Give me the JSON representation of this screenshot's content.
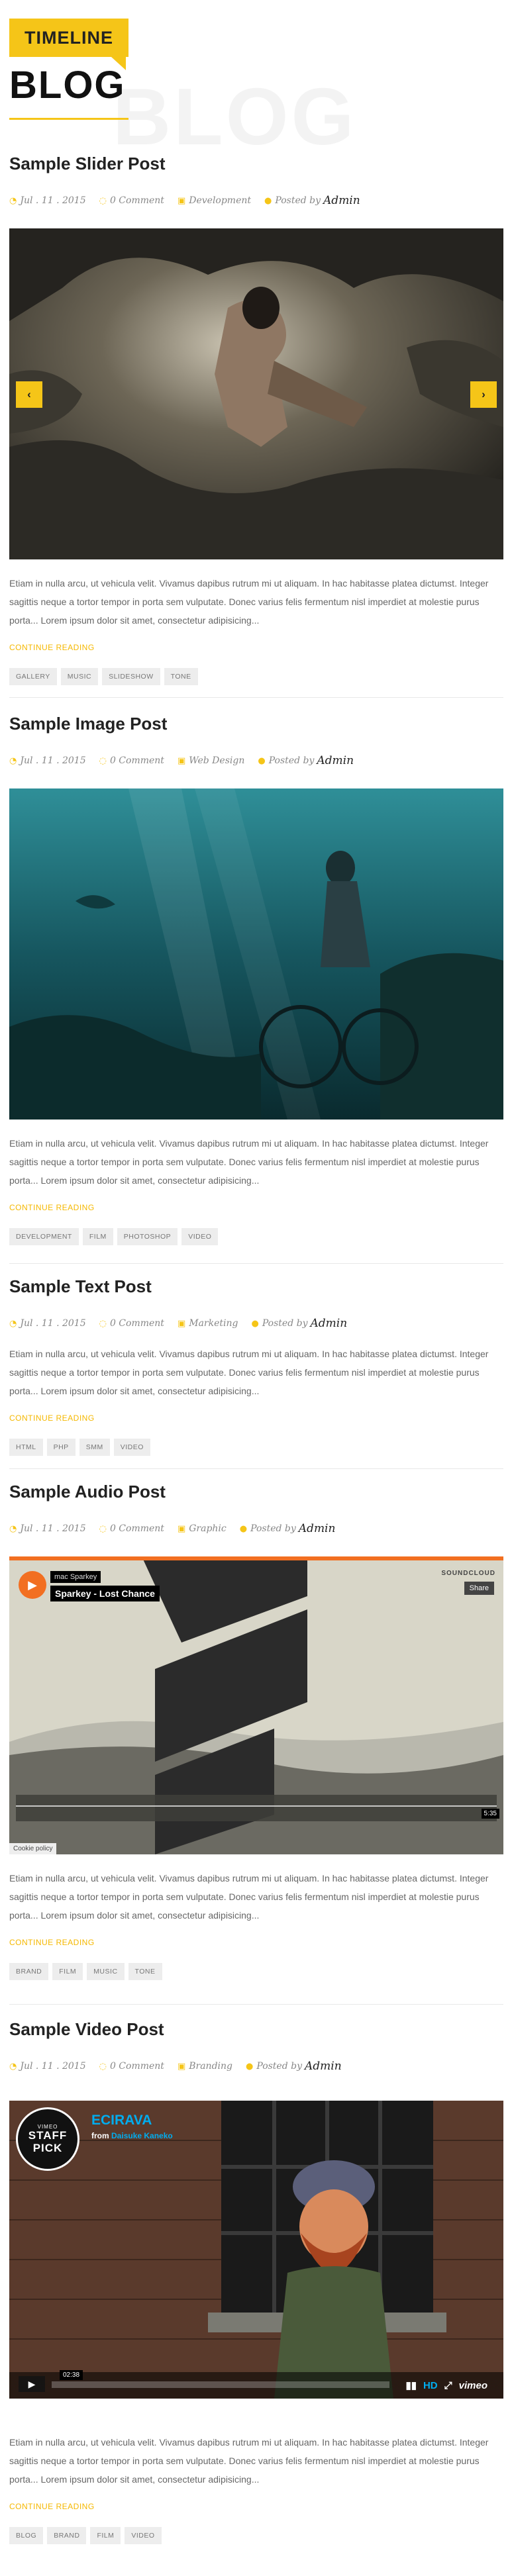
{
  "header": {
    "badge": "TIMELINE",
    "title": "BLOG",
    "watermark": "BLOG"
  },
  "colors": {
    "accent": "#f5c518",
    "soundcloud": "#f26f21",
    "vimeo": "#00adef"
  },
  "posts": [
    {
      "title": "Sample Slider Post",
      "date": "Jul . 11 . 2015",
      "comments": "0 Comment",
      "category": "Development",
      "posted_by": "Posted by",
      "author": "Admin",
      "excerpt": "Etiam in nulla arcu, ut vehicula velit. Vivamus dapibus rutrum mi ut aliquam. In hac habitasse platea dictumst. Integer sagittis neque a tortor tempor in porta sem vulputate. Donec varius felis fermentum nisl imperdiet at molestie purus porta... Lorem ipsum dolor sit amet, consectetur adipisicing...",
      "read_more": "CONTINUE READING",
      "tags": [
        "GALLERY",
        "MUSIC",
        "SLIDESHOW",
        "TONE"
      ],
      "media": {
        "prev_icon": "chevron-left-icon",
        "next_icon": "chevron-right-icon"
      }
    },
    {
      "title": "Sample Image Post",
      "date": "Jul . 11 . 2015",
      "comments": "0 Comment",
      "category": "Web Design",
      "posted_by": "Posted by",
      "author": "Admin",
      "excerpt": "Etiam in nulla arcu, ut vehicula velit. Vivamus dapibus rutrum mi ut aliquam. In hac habitasse platea dictumst. Integer sagittis neque a tortor tempor in porta sem vulputate. Donec varius felis fermentum nisl imperdiet at molestie purus porta... Lorem ipsum dolor sit amet, consectetur adipisicing...",
      "read_more": "CONTINUE READING",
      "tags": [
        "DEVELOPMENT",
        "FILM",
        "PHOTOSHOP",
        "VIDEO"
      ]
    },
    {
      "title": "Sample Text Post",
      "date": "Jul . 11 . 2015",
      "comments": "0 Comment",
      "category": "Marketing",
      "posted_by": "Posted by",
      "author": "Admin",
      "excerpt": "Etiam in nulla arcu, ut vehicula velit. Vivamus dapibus rutrum mi ut aliquam. In hac habitasse platea dictumst. Integer sagittis neque a tortor tempor in porta sem vulputate. Donec varius felis fermentum nisl imperdiet at molestie purus porta... Lorem ipsum dolor sit amet, consectetur adipisicing...",
      "read_more": "CONTINUE READING",
      "tags": [
        "HTML",
        "PHP",
        "SMM",
        "VIDEO"
      ]
    },
    {
      "title": "Sample Audio Post",
      "date": "Jul . 11 . 2015",
      "comments": "0 Comment",
      "category": "Graphic",
      "posted_by": "Posted by",
      "author": "Admin",
      "excerpt": "Etiam in nulla arcu, ut vehicula velit. Vivamus dapibus rutrum mi ut aliquam. In hac habitasse platea dictumst. Integer sagittis neque a tortor tempor in porta sem vulputate. Donec varius felis fermentum nisl imperdiet at molestie purus porta... Lorem ipsum dolor sit amet, consectetur adipisicing...",
      "read_more": "CONTINUE READING",
      "tags": [
        "BRAND",
        "FILM",
        "MUSIC",
        "TONE"
      ],
      "player": {
        "artist": "mac Sparkey",
        "track": "Sparkey - Lost Chance",
        "logo": "SOUNDCLOUD",
        "share": "Share",
        "time": "5:35",
        "cookie": "Cookie policy"
      }
    },
    {
      "title": "Sample Video Post",
      "date": "Jul . 11 . 2015",
      "comments": "0 Comment",
      "category": "Branding",
      "posted_by": "Posted by",
      "author": "Admin",
      "excerpt": "Etiam in nulla arcu, ut vehicula velit. Vivamus dapibus rutrum mi ut aliquam. In hac habitasse platea dictumst. Integer sagittis neque a tortor tempor in porta sem vulputate. Donec varius felis fermentum nisl imperdiet at molestie purus porta... Lorem ipsum dolor sit amet, consectetur adipisicing...",
      "read_more": "CONTINUE READING",
      "tags": [
        "BLOG",
        "BRAND",
        "FILM",
        "VIDEO"
      ],
      "player": {
        "avatar_top": "VIMEO",
        "avatar_line1": "STAFF",
        "avatar_line2": "PICK",
        "title": "ECIRAVA",
        "from": "from",
        "author": "Daisuke Kaneko",
        "time": "02:38",
        "hd": "HD",
        "logo": "vimeo"
      }
    }
  ]
}
